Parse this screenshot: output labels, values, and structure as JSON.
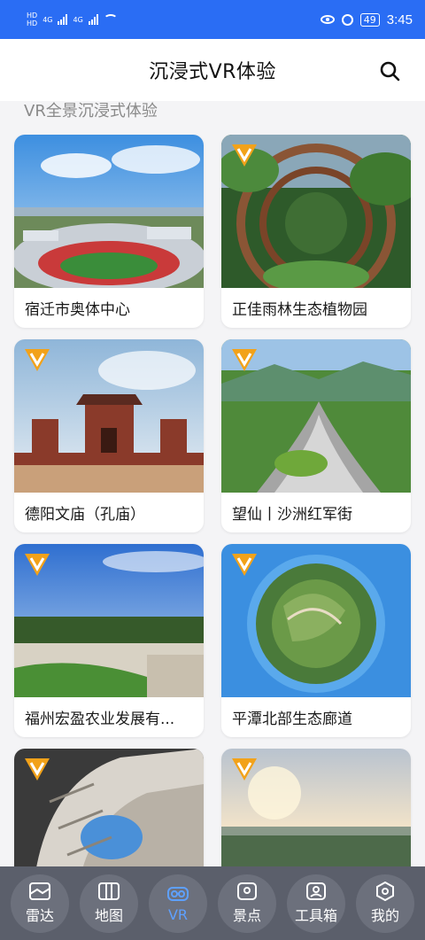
{
  "status_bar": {
    "left_tags": [
      "HD",
      "HD"
    ],
    "network": [
      "4G",
      "4G"
    ],
    "battery": "49",
    "time": "3:45"
  },
  "header": {
    "title": "沉浸式VR体验",
    "search_icon": "search-icon"
  },
  "section": {
    "title": "VR全景沉浸式体验"
  },
  "cards": [
    {
      "label": "宿迁市奥体中心",
      "vip": false
    },
    {
      "label": "正佳雨林生态植物园",
      "vip": true
    },
    {
      "label": "德阳文庙（孔庙）",
      "vip": true
    },
    {
      "label": "望仙丨沙洲红军街",
      "vip": true
    },
    {
      "label": "福州宏盈农业发展有...",
      "vip": true
    },
    {
      "label": "平潭北部生态廊道",
      "vip": true
    },
    {
      "label": "",
      "vip": true
    },
    {
      "label": "",
      "vip": true
    }
  ],
  "nav": {
    "items": [
      {
        "label": "雷达",
        "icon": "radar-map-icon"
      },
      {
        "label": "地图",
        "icon": "map-icon"
      },
      {
        "label": "VR",
        "icon": "vr-glasses-icon"
      },
      {
        "label": "景点",
        "icon": "scenic-photo-icon"
      },
      {
        "label": "工具箱",
        "icon": "toolbox-icon"
      },
      {
        "label": "我的",
        "icon": "profile-icon"
      }
    ],
    "active_index": 2
  },
  "colors": {
    "status_bar": "#2a6df4",
    "vip_badge": "#f2a21a",
    "nav_active": "#5ea0ff"
  }
}
